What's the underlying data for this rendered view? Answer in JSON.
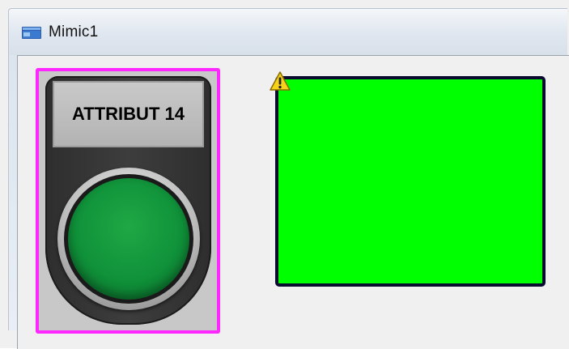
{
  "window": {
    "title": "Mimic1",
    "icon": "mimic-window-icon"
  },
  "pushbutton": {
    "label": "ATTRIBUT 14",
    "cap_color": "#10923a",
    "selection_color": "#ff27ff"
  },
  "status_rectangle": {
    "fill_color": "#00ff00",
    "border_color": "#0a0a2e",
    "warning_icon": "warning-icon"
  }
}
